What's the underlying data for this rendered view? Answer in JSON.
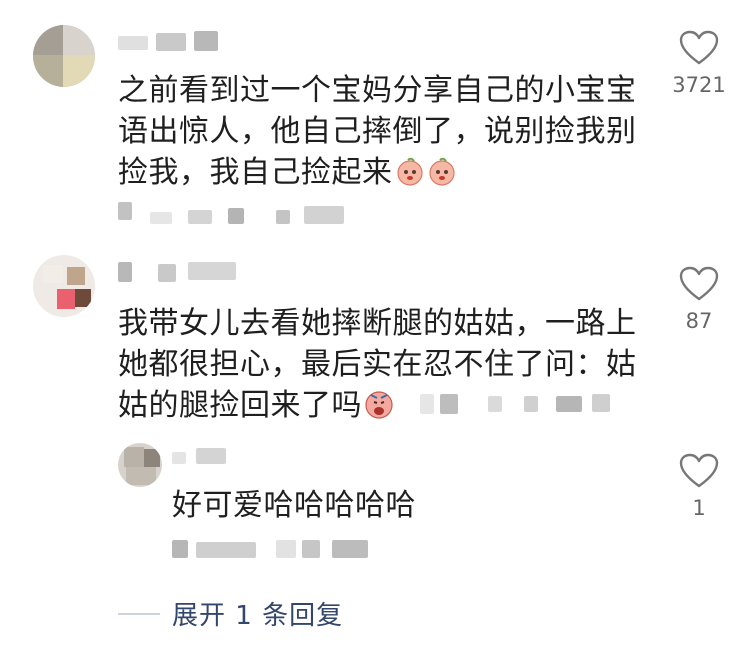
{
  "comments": [
    {
      "text_lines": [
        "之前看到过一个宝妈分享自己的小宝宝",
        "语出惊人，他自己摔倒了，说别捡我别",
        "捡我，我自己捡起来"
      ],
      "emojis": [
        "peach-face-emoji",
        "peach-face-emoji"
      ],
      "likes": "3721"
    },
    {
      "text_lines": [
        "我带女儿去看她摔断腿的姑姑，一路上",
        "她都很担心，最后实在忍不住了问：姑",
        "姑的腿捡回来了吗"
      ],
      "emojis": [
        "crying-face-emoji"
      ],
      "likes": "87"
    }
  ],
  "reply": {
    "text": "好可爱哈哈哈哈哈",
    "likes": "1"
  },
  "expand_replies": "展开 1 条回复",
  "colors": {
    "text": "#1f1f1f",
    "meta": "#666666",
    "link": "#33466b",
    "blur": "#cfcfcf"
  },
  "icons": [
    "heart-outline-icon"
  ]
}
